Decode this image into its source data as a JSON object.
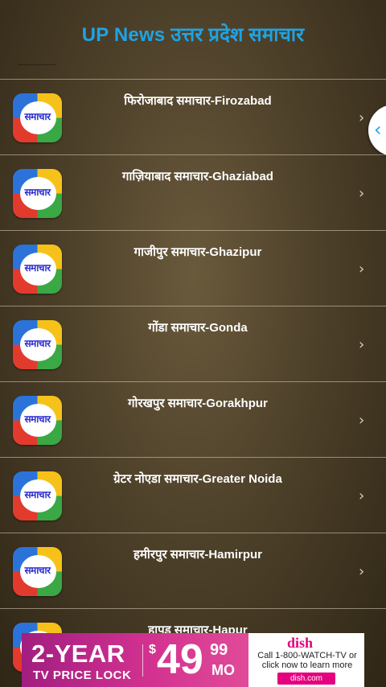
{
  "header": {
    "title": "UP News उत्तर प्रदेश समाचार"
  },
  "logo_text": "समाचार",
  "chevron": "›",
  "side_tab_icon": "‹",
  "items": [
    {
      "label": "फिरोजाबाद समाचार-Firozabad"
    },
    {
      "label": "गाज़ियाबाद समाचार-Ghaziabad"
    },
    {
      "label": "गाजीपुर समाचार-Ghazipur"
    },
    {
      "label": "गोंडा समाचार-Gonda"
    },
    {
      "label": "गोरखपुर समाचार-Gorakhpur"
    },
    {
      "label": "ग्रेटर नोएडा समाचार-Greater Noida"
    },
    {
      "label": "हमीरपुर समाचार-Hamirpur"
    },
    {
      "label": "हापुड़ समाचार-Hapur"
    }
  ],
  "ad": {
    "headline": "2-YEAR",
    "subline": "TV PRICE LOCK",
    "dollar": "$",
    "price": "49",
    "cents": "99",
    "per": "MO",
    "brand": "dish",
    "call_text": "Call 1-800-WATCH-TV or click now to learn more",
    "url": "dish.com"
  }
}
